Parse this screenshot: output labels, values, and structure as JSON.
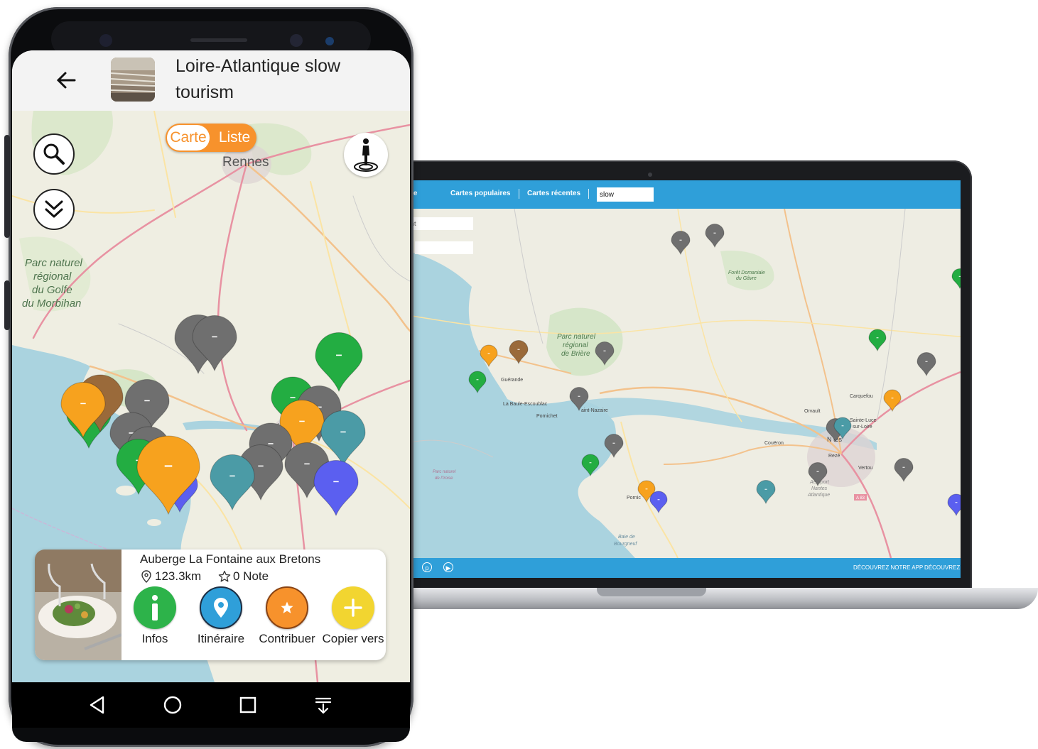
{
  "app": {
    "title": "Loire-Atlantique slow tourism"
  },
  "view_toggle": {
    "map_label": "Carte",
    "list_label": "Liste",
    "active": "Carte"
  },
  "map_labels": {
    "rennes": "Rennes",
    "nantes_partial": "tes",
    "parc_naturel": "Parc naturel",
    "regional": "régional",
    "golfe": "du Golfe",
    "morbihan": "du Morbihan"
  },
  "place_card": {
    "name": "Auberge La Fontaine aux Bretons",
    "distance": "123.3km",
    "rating": "0 Note",
    "actions": [
      {
        "label": "Infos",
        "color": "#2db34a"
      },
      {
        "label": "Itinéraire",
        "color": "#2f9fd9"
      },
      {
        "label": "Contribuer",
        "color": "#f7922c"
      },
      {
        "label": "Copier vers",
        "color": "#f2d530"
      }
    ]
  },
  "web": {
    "nav_partial": "re",
    "nav_popular": "Cartes populaires",
    "nav_recent": "Cartes récentes",
    "search_value": "slow",
    "left_field_partial": "nt",
    "footer_discover": "DÉCOUVREZ NOTRE APP",
    "footer_discover2": "DÉCOUVREZ N",
    "map_labels": {
      "parc1": "Parc naturel",
      "parc2": "régional",
      "parc3": "de Brière",
      "foret1": "Forêt Domaniale",
      "foret2": "du Gâvre",
      "guerande": "Guérande",
      "labaule": "La Baule-Escoublac",
      "pornichet": "Pornichet",
      "stnazaire": "aint-Nazaire",
      "coueron": "Couëron",
      "orvault": "Orvault",
      "carquefou": "Carquefou",
      "sainteluce": "Sainte-Luce",
      "surloire": "sur-Loire",
      "nantes": "N  tes",
      "reze": "Rezé",
      "vertou": "Vertou",
      "pornic": "Pornic",
      "airport1": "Aéroport",
      "airport2": "Nantes",
      "airport3": "Atlantique",
      "baie1": "Baie de",
      "baie2": "Bourgneuf",
      "marin1": "Parc naturel",
      "marin2": "de l'Iroise",
      "a83": "A 83"
    }
  },
  "colors": {
    "marker_gray": "#6f6f6f",
    "marker_green": "#23ad42",
    "marker_orange": "#f7a21e",
    "marker_brown": "#9a6a3a",
    "marker_teal": "#4b9ba6",
    "marker_blue": "#5b5ff0",
    "web_header": "#2f9fd9",
    "sea": "#aad3df",
    "land": "#efeee2"
  }
}
